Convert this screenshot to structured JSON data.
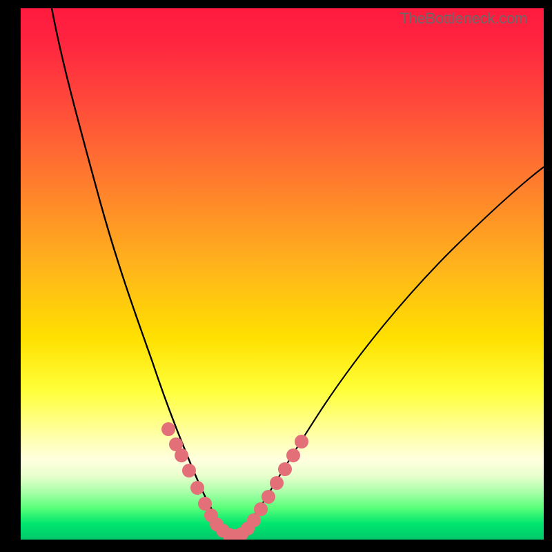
{
  "watermark": "TheBottleneck.com",
  "chart_data": {
    "type": "line",
    "title": "",
    "xlabel": "",
    "ylabel": "",
    "xlim": [
      0,
      100
    ],
    "ylim": [
      0,
      100
    ],
    "series": [
      {
        "name": "left-curve",
        "stroke": "#000000",
        "x": [
          6,
          8,
          10,
          13,
          16,
          20,
          24,
          27,
          28.5,
          30,
          31,
          32,
          33,
          34,
          35,
          36,
          37,
          38,
          39,
          40
        ],
        "y": [
          100,
          88,
          76,
          62,
          50,
          38,
          28,
          22,
          20,
          18,
          16.5,
          15,
          13,
          11,
          9,
          7,
          5.5,
          4,
          3,
          2
        ]
      },
      {
        "name": "right-curve",
        "stroke": "#000000",
        "x": [
          40,
          41,
          42,
          43,
          44,
          46,
          48,
          50,
          53,
          57,
          62,
          68,
          75,
          82,
          90,
          98,
          100
        ],
        "y": [
          2,
          3,
          4.5,
          6,
          8,
          11,
          14,
          17,
          21,
          26,
          32,
          39,
          47,
          54,
          62,
          68,
          70
        ]
      },
      {
        "name": "dot-overlay",
        "type": "scatter",
        "color": "#e36f78",
        "radius": 10,
        "x": [
          28.5,
          30,
          30.8,
          32,
          33.5,
          35,
          36,
          37,
          38,
          39,
          40,
          41,
          42,
          43,
          44,
          45.5,
          47,
          48.5,
          50,
          51.5
        ],
        "y": [
          20,
          18,
          16.5,
          14.5,
          12,
          9,
          7,
          5.5,
          4,
          3,
          2,
          3,
          4.5,
          6,
          8,
          10,
          12.5,
          15,
          17.5,
          20
        ]
      }
    ],
    "grid": false,
    "legend": false
  }
}
